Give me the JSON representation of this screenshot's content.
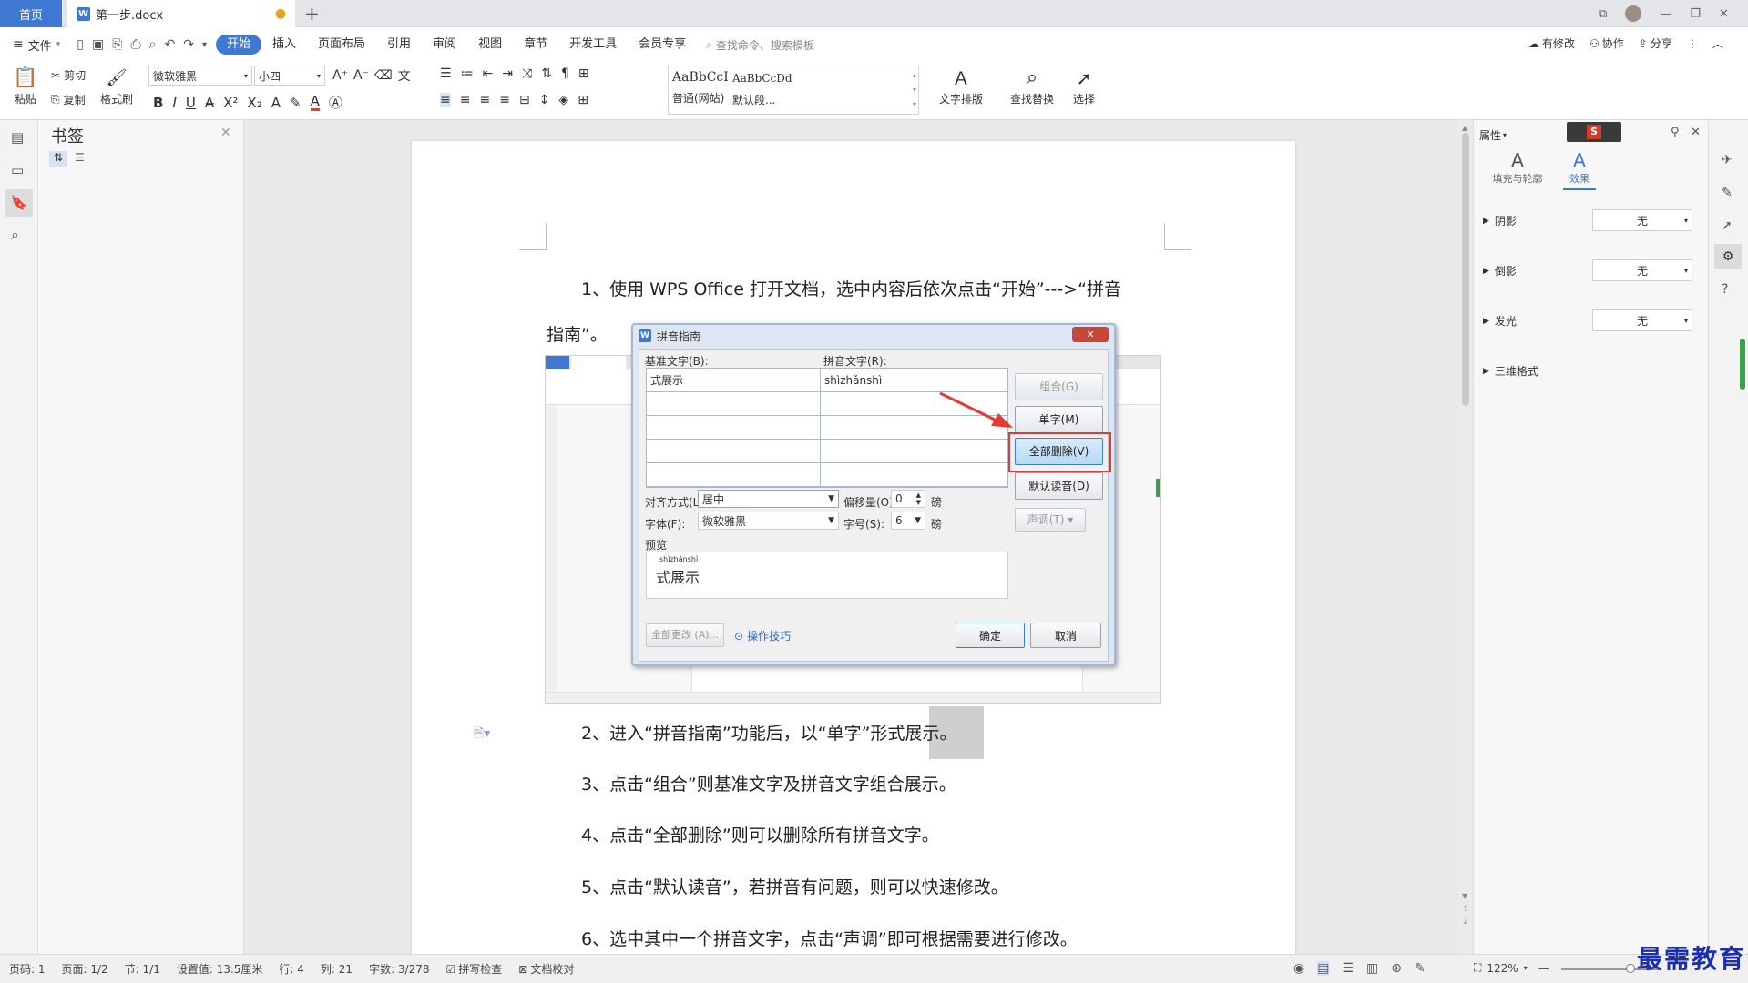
{
  "tabs": {
    "home": "首页",
    "doc": "第一步.docx"
  },
  "menu": {
    "file": "文件",
    "items": [
      "开始",
      "插入",
      "页面布局",
      "引用",
      "审阅",
      "视图",
      "章节",
      "开发工具",
      "会员专享"
    ],
    "search": "查找命令、搜索模板",
    "right": [
      "有修改",
      "协作",
      "分享"
    ]
  },
  "ribbon": {
    "paste": "粘贴",
    "cut": "剪切",
    "copy": "复制",
    "format_painter": "格式刷",
    "font": "微软雅黑",
    "size": "小四",
    "style1_preview": "AaBbCcI",
    "style1_name": "普通(网站)",
    "style2_preview": "AaBbCcDd",
    "style2_name": "默认段...",
    "text_layout": "文字排版",
    "find_replace": "查找替换",
    "select": "选择"
  },
  "left_panel": {
    "title": "书签"
  },
  "document": {
    "p1a": "1、使用 WPS Office 打开文档，选中内容后依次点击“开始”--->“拼音",
    "p1b": "指南”。",
    "p2": "2、进入“拼音指南”功能后，以“单字”形式展示。",
    "p3": "3、点击“组合”则基准文字及拼音文字组合展示。",
    "p4": "4、点击“全部删除”则可以删除所有拼音文字。",
    "p5": "5、点击“默认读音”，若拼音有问题，则可以快速修改。",
    "p6": "6、选中其中一个拼音文字，点击“声调”即可根据需要进行修改。"
  },
  "dialog": {
    "title": "拼音指南",
    "base_label": "基准文字(B):",
    "pinyin_label": "拼音文字(R):",
    "base_value": "式展示",
    "pinyin_value": "shìzhǎnshì",
    "btn_combine": "组合(G)",
    "btn_single": "单字(M)",
    "btn_delete_all": "全部删除(V)",
    "btn_default": "默认读音(D)",
    "btn_tone": "声调(T)",
    "align_label": "对齐方式(L):",
    "align_value": "居中",
    "offset_label": "偏移量(O):",
    "offset_value": "0",
    "unit1": "磅",
    "font_label": "字体(F):",
    "font_value": "微软雅黑",
    "size_label": "字号(S):",
    "size_value": "6",
    "unit2": "磅",
    "preview_label": "预览",
    "preview_pinyin": "shìzhǎnshì",
    "preview_text": "式展示",
    "btn_change_all": "全部更改 (A)...",
    "tips": "操作技巧",
    "ok": "确定",
    "cancel": "取消"
  },
  "right_panel": {
    "title": "属性",
    "tab1": "填充与轮廓",
    "tab2": "效果",
    "rows": [
      {
        "label": "阴影",
        "value": "无"
      },
      {
        "label": "倒影",
        "value": "无"
      },
      {
        "label": "发光",
        "value": "无"
      },
      {
        "label": "三维格式",
        "value": ""
      }
    ]
  },
  "status": {
    "items": [
      "页码: 1",
      "页面: 1/2",
      "节: 1/1",
      "设置值: 13.5厘米",
      "行: 4",
      "列: 21",
      "字数: 3/278",
      "拼写检查",
      "文档校对"
    ],
    "zoom": "122%"
  },
  "watermark": "最需教育",
  "colors": {
    "accent": "#3f78d1",
    "highlight": "#e53935"
  }
}
